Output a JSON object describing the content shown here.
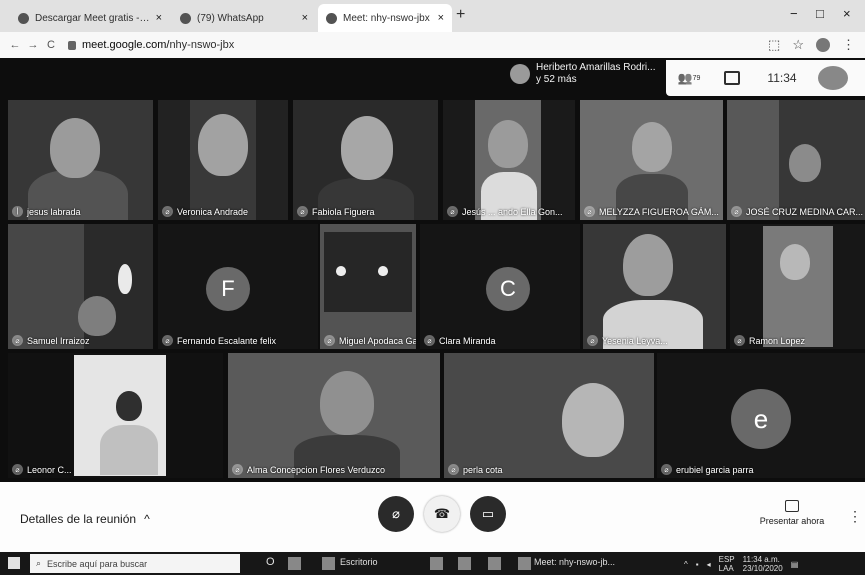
{
  "browser": {
    "tabs": [
      {
        "title": "Descargar Meet gratis - Última",
        "close": "×"
      },
      {
        "title": "(79) WhatsApp",
        "close": "×"
      },
      {
        "title": "Meet: nhy-nswo-jbx",
        "close": "×"
      }
    ],
    "new_tab": "+",
    "window_controls": [
      "−",
      "□",
      "×"
    ],
    "nav": {
      "back": "←",
      "forward": "→",
      "reload": "C"
    },
    "url_domain": "meet.google.com/",
    "url_path": "nhy-nswo-jbx"
  },
  "meet": {
    "presenter_name": "Heriberto Amarillas Rodri...",
    "presenter_more": "y 52 más",
    "participants_count": "79",
    "clock": "11:34",
    "participants": [
      {
        "name": "jesus labrada",
        "kind": "video"
      },
      {
        "name": "Veronica Andrade",
        "kind": "video"
      },
      {
        "name": "Fabiola Figuera",
        "kind": "video"
      },
      {
        "name": "Jesús ... ando Ella Gon...",
        "kind": "video"
      },
      {
        "name": "MELYZZA FIGUEROA GÁM...",
        "kind": "video"
      },
      {
        "name": "JOSÉ CRUZ MEDINA CAR...",
        "kind": "video"
      },
      {
        "name": "Samuel Irraizoz",
        "kind": "video"
      },
      {
        "name": "Fernando Escalante felix",
        "kind": "initial",
        "initial": "F"
      },
      {
        "name": "Miguel Apodaca Gaxiola",
        "kind": "video"
      },
      {
        "name": "Clara Miranda",
        "kind": "initial",
        "initial": "C"
      },
      {
        "name": "Yesenia Leyva...",
        "kind": "video"
      },
      {
        "name": "Ramon Lopez",
        "kind": "video"
      },
      {
        "name": "Leonor C...",
        "kind": "video"
      },
      {
        "name": "Alma Concepcion Flores Verduzco",
        "kind": "video"
      },
      {
        "name": "perla cota",
        "kind": "video"
      },
      {
        "name": "erubiel garcia parra",
        "kind": "initial",
        "initial": "e"
      }
    ]
  },
  "bottom": {
    "details_label": "Detalles de la reunión",
    "present_label": "Presentar ahora"
  },
  "taskbar": {
    "search_placeholder": "Escribe aquí para buscar",
    "escritorio": "Escritorio",
    "meet_item": "Meet: nhy-nswo-jb...",
    "lang": "ESP",
    "lang2": "LAA",
    "time": "11:34 a.m.",
    "date": "23/10/2020"
  },
  "colors": {
    "end_call": "#7a1a1a",
    "bottom_bar": "#f7f7f7"
  }
}
